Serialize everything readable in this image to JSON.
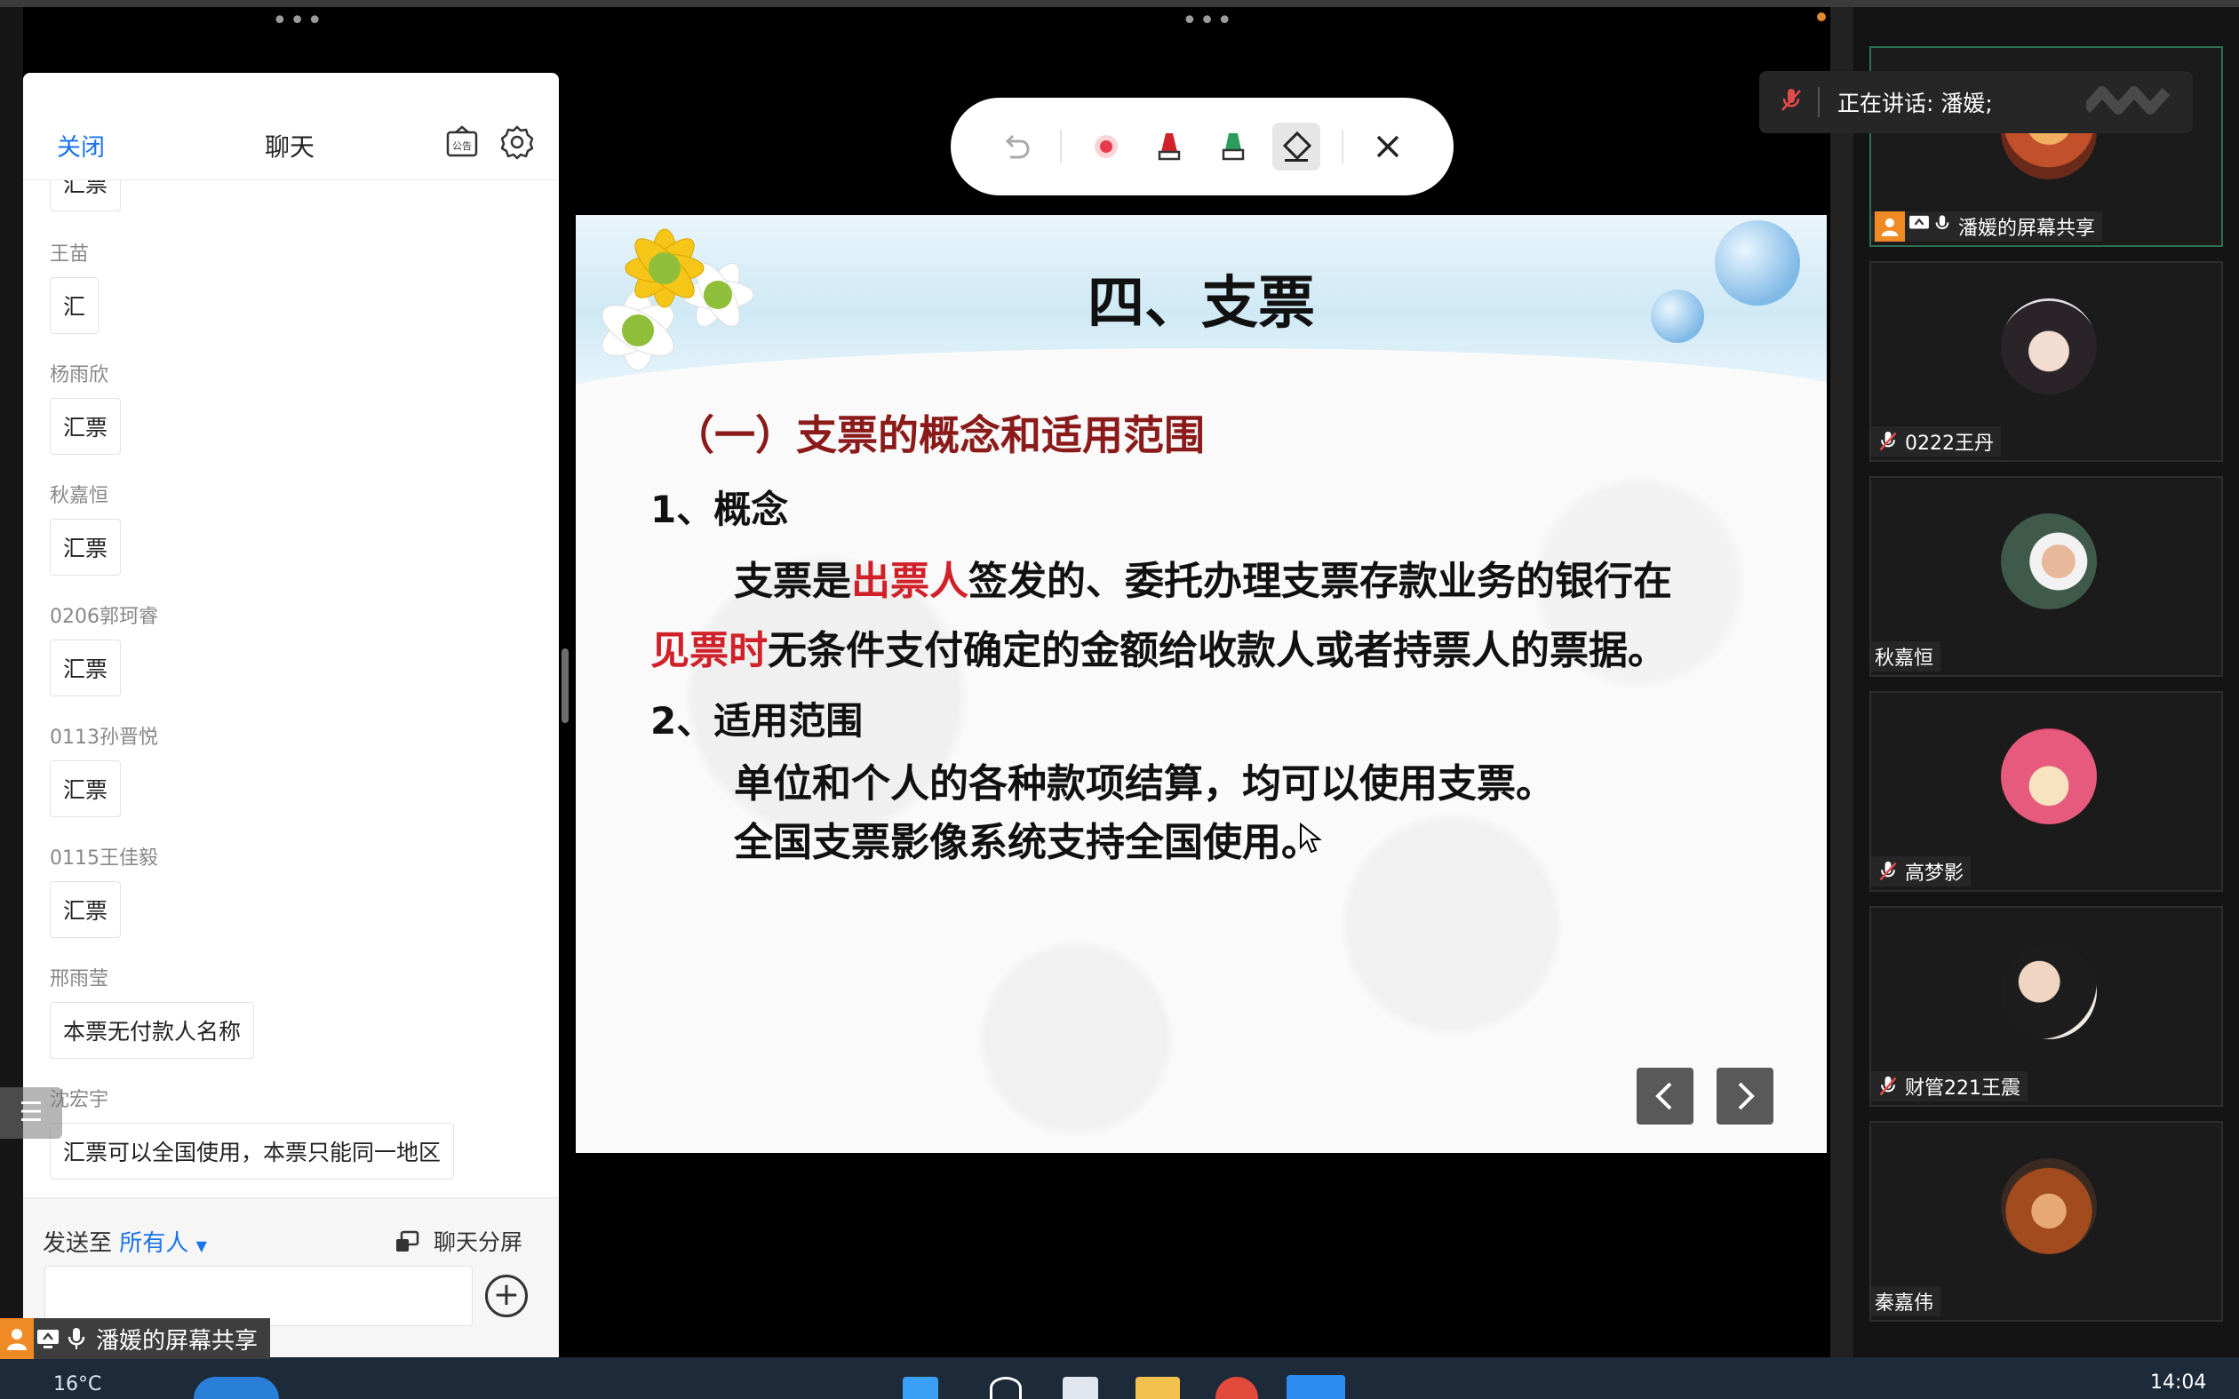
{
  "chat": {
    "close_label": "关闭",
    "title": "聊天",
    "announcement_icon_label": "公告",
    "messages": [
      {
        "sender": "",
        "text": "汇票"
      },
      {
        "sender": "王苗",
        "text": "汇"
      },
      {
        "sender": "杨雨欣",
        "text": "汇票"
      },
      {
        "sender": "秋嘉恒",
        "text": "汇票"
      },
      {
        "sender": "0206郭珂睿",
        "text": "汇票"
      },
      {
        "sender": "0113孙晋悦",
        "text": "汇票"
      },
      {
        "sender": "0115王佳毅",
        "text": "汇票"
      },
      {
        "sender": "邢雨莹",
        "text": "本票无付款人名称"
      },
      {
        "sender": "沈宏宇",
        "text": "汇票可以全国使用，本票只能同一地区"
      }
    ],
    "send_to_label": "发送至",
    "send_to_target": "所有人",
    "split_label": "聊天分屏"
  },
  "share_badge": {
    "label": "潘媛的屏幕共享"
  },
  "annotation_toolbar": {
    "tools": [
      "undo-icon",
      "laser-pointer-icon",
      "red-pen-icon",
      "green-highlighter-icon",
      "eraser-icon",
      "close-icon"
    ],
    "selected": "eraser-icon"
  },
  "slide": {
    "title": "四、支票",
    "subheading": "（一）支票的概念和适用范围",
    "section1_heading": "1、概念",
    "section1_line1_a": "支票是",
    "section1_line1_b": "出票人",
    "section1_line1_c": "签发的、委托办理支票存款业务的银行在",
    "section1_line2_a": "见票时",
    "section1_line2_b": "无条件支付确定的金额给收款人或者持票人的票据。",
    "section2_heading": "2、适用范围",
    "section2_line1": "单位和个人的各种款项结算，均可以使用支票。",
    "section2_line2": "全国支票影像系统支持全国使用。",
    "accent_color": "#d0212a"
  },
  "participants": {
    "speaking_label": "正在讲话: 潘媛;",
    "tiles": [
      {
        "name": "潘媛的屏幕共享",
        "muted": false,
        "active": true
      },
      {
        "name": "0222王丹",
        "muted": true
      },
      {
        "name": "秋嘉恒",
        "muted": false
      },
      {
        "name": "高梦影",
        "muted": true
      },
      {
        "name": "财管221王震",
        "muted": true
      },
      {
        "name": "秦嘉伟",
        "muted": false
      }
    ]
  },
  "taskbar": {
    "weather": "16°C",
    "time": "14:04"
  }
}
